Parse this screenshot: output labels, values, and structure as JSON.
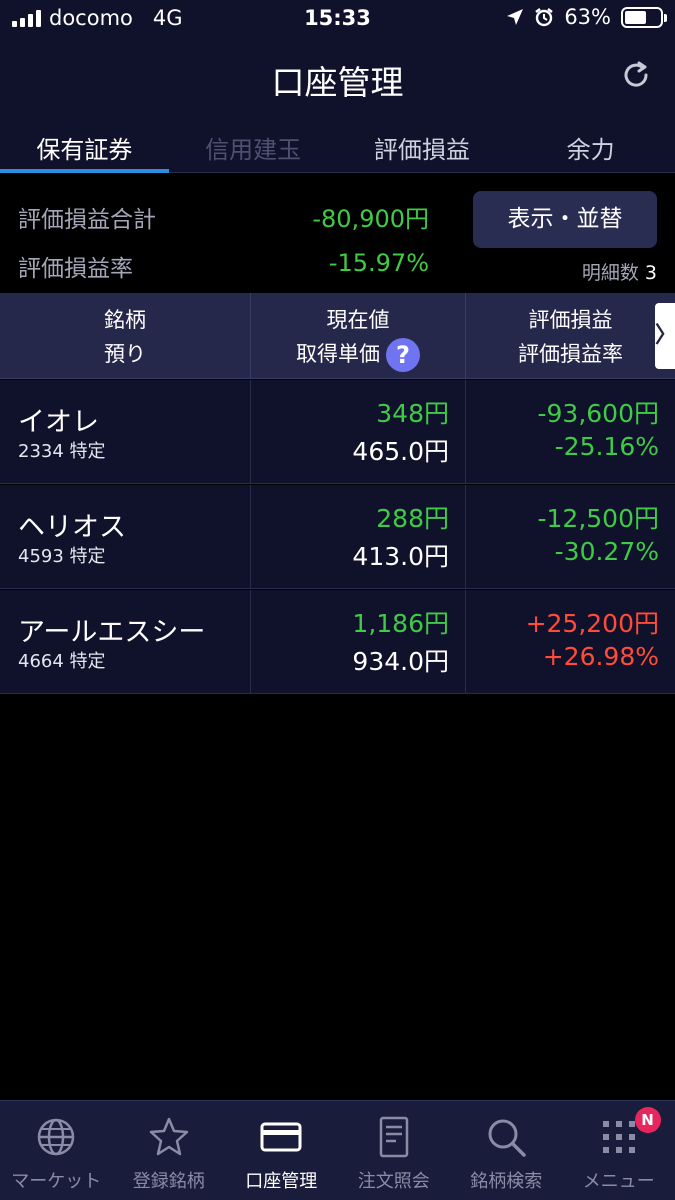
{
  "status_bar": {
    "carrier": "docomo",
    "network": "4G",
    "time": "15:33",
    "battery": "63%"
  },
  "header": {
    "title": "口座管理"
  },
  "tabs": [
    {
      "label": "保有証券",
      "state": "active"
    },
    {
      "label": "信用建玉",
      "state": "disabled"
    },
    {
      "label": "評価損益",
      "state": "normal"
    },
    {
      "label": "余力",
      "state": "normal"
    }
  ],
  "summary": {
    "total_label": "評価損益合計",
    "total_value": "-80,900円",
    "rate_label": "評価損益率",
    "rate_value": "-15.97%",
    "display_button": "表示・並替",
    "detail_label": "明細数",
    "detail_count": "3"
  },
  "table": {
    "headers": {
      "col1_line1": "銘柄",
      "col1_line2": "預り",
      "col2_line1": "現在値",
      "col2_line2": "取得単価",
      "col3_line1": "評価損益",
      "col3_line2": "評価損益率"
    },
    "help_icon_glyph": "?",
    "scroll_glyph": "〉",
    "rows": [
      {
        "name": "イオレ",
        "code": "2334 特定",
        "price": "348円",
        "cost": "465.0円",
        "pl": "-93,600円",
        "rate": "-25.16%",
        "pl_color": "green"
      },
      {
        "name": "ヘリオス",
        "code": "4593 特定",
        "price": "288円",
        "cost": "413.0円",
        "pl": "-12,500円",
        "rate": "-30.27%",
        "pl_color": "green"
      },
      {
        "name": "アールエスシー",
        "code": "4664 特定",
        "price": "1,186円",
        "cost": "934.0円",
        "pl": "+25,200円",
        "rate": "+26.98%",
        "pl_color": "red"
      }
    ]
  },
  "tabbar": {
    "items": [
      {
        "label": "マーケット",
        "icon": "globe-icon"
      },
      {
        "label": "登録銘柄",
        "icon": "star-icon"
      },
      {
        "label": "口座管理",
        "icon": "card-icon"
      },
      {
        "label": "注文照会",
        "icon": "document-icon"
      },
      {
        "label": "銘柄検索",
        "icon": "search-icon"
      },
      {
        "label": "メニュー",
        "icon": "grid-icon"
      }
    ],
    "badge": "N"
  },
  "colors": {
    "positive_green": "#3fcb45",
    "negative_red": "#ff4b3a",
    "accent_blue": "#2b8fe0",
    "nav_bg": "#10112b"
  }
}
